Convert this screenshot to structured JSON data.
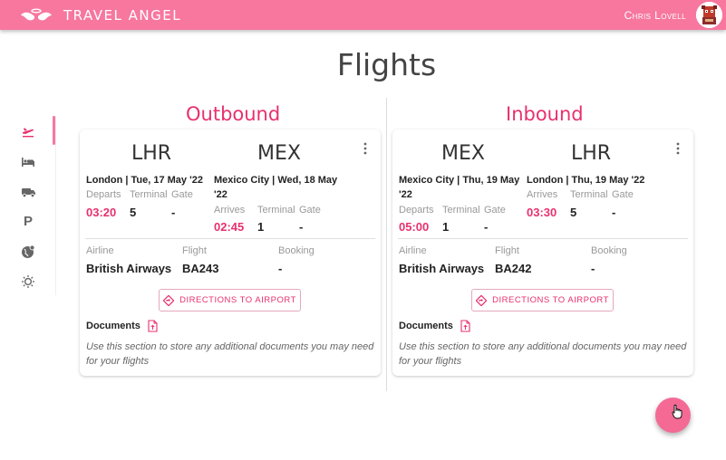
{
  "app": {
    "title": "TRAVEL ANGEL",
    "user_name": "Chris Lovell"
  },
  "page": {
    "title": "Flights"
  },
  "sidenav": {
    "items": [
      {
        "icon": "flight-icon"
      },
      {
        "icon": "bed-icon"
      },
      {
        "icon": "car-icon"
      },
      {
        "icon": "parking-icon",
        "label": "P"
      },
      {
        "icon": "globe-icon"
      },
      {
        "icon": "sun-icon"
      }
    ]
  },
  "outbound": {
    "section_title": "Outbound",
    "from_code": "LHR",
    "to_code": "MEX",
    "depart_city_line1": "London | Tue, 17 May '22",
    "arrive_city_line1": "Mexico City | Wed, 18 May",
    "arrive_city_line2": "'22",
    "departs_label": "Departs",
    "terminal_label": "Terminal",
    "gate_label": "Gate",
    "arrives_label": "Arrives",
    "departs_time": "03:20",
    "departs_terminal": "5",
    "departs_gate": "-",
    "arrives_time": "02:45",
    "arrives_terminal": "1",
    "arrives_gate": "-",
    "airline_label": "Airline",
    "flight_label": "Flight",
    "booking_label": "Booking",
    "airline": "British Airways",
    "flight": "BA243",
    "booking": "-",
    "directions_label": "DIRECTIONS TO AIRPORT",
    "documents_label": "Documents",
    "documents_hint": "Use this section to store any additional documents you may need for your flights"
  },
  "inbound": {
    "section_title": "Inbound",
    "from_code": "MEX",
    "to_code": "LHR",
    "depart_city_line1": "Mexico City | Thu, 19 May",
    "depart_city_line2": "'22",
    "arrive_city_line1": "London | Thu, 19 May '22",
    "departs_label": "Departs",
    "terminal_label": "Terminal",
    "gate_label": "Gate",
    "arrives_label": "Arrives",
    "departs_time": "05:00",
    "departs_terminal": "1",
    "departs_gate": "-",
    "arrives_time": "03:30",
    "arrives_terminal": "5",
    "arrives_gate": "-",
    "airline_label": "Airline",
    "flight_label": "Flight",
    "booking_label": "Booking",
    "airline": "British Airways",
    "flight": "BA242",
    "booking": "-",
    "directions_label": "DIRECTIONS TO AIRPORT",
    "documents_label": "Documents",
    "documents_hint": "Use this section to store any additional documents you may need for your flights"
  },
  "colors": {
    "brand": "#f7779f",
    "accent": "#e8306f"
  }
}
